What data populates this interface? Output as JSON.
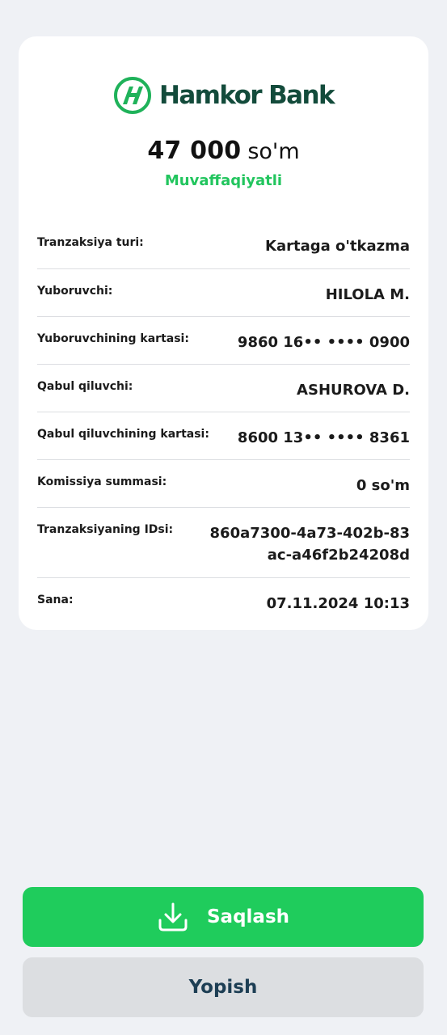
{
  "brand": {
    "name": "Hamkor Bank",
    "logo_icon": "hamkor-h-logo-icon",
    "color": "#134b3b"
  },
  "amount": {
    "value": "47 000",
    "currency": "so'm"
  },
  "status": {
    "text": "Muvaffaqiyatli",
    "color": "#22c55e"
  },
  "details": [
    {
      "label": "Tranzaksiya turi:",
      "value": [
        "Kartaga o'tkazma"
      ]
    },
    {
      "label": "Yuboruvchi:",
      "value": [
        "HILOLA M."
      ]
    },
    {
      "label": "Yuboruvchining kartasi:",
      "value": [
        "9860 16•• •••• 0900"
      ]
    },
    {
      "label": "Qabul qiluvchi:",
      "value": [
        "ASHUROVA D."
      ]
    },
    {
      "label": "Qabul qiluvchining kartasi:",
      "value": [
        "8600 13•• •••• 8361"
      ]
    },
    {
      "label": "Komissiya summasi:",
      "value": [
        "0 so'm"
      ]
    },
    {
      "label": "Tranzaksiyaning IDsi:",
      "value": [
        "860a7300-4a73-402b-83",
        "ac-a46f2b24208d"
      ]
    },
    {
      "label": "Sana:",
      "value": [
        "07.11.2024 10:13"
      ]
    }
  ],
  "actions": {
    "save": {
      "label": "Saqlash",
      "icon": "download-icon",
      "color": "#1fcc5c"
    },
    "close": {
      "label": "Yopish",
      "color": "#dcdee1"
    }
  }
}
